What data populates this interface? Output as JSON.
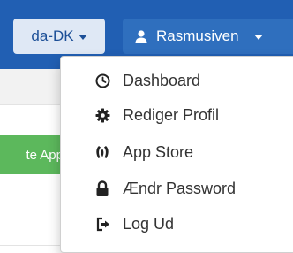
{
  "navbar": {
    "language": {
      "label": "da-DK"
    },
    "user": {
      "name": "Rasmusiven"
    }
  },
  "page": {
    "partial_button_label": "te App"
  },
  "user_menu": {
    "items": [
      {
        "label": "Dashboard",
        "icon": "dashboard-icon"
      },
      {
        "label": "Rediger Profil",
        "icon": "gear-icon"
      },
      {
        "label": "App Store",
        "icon": "app-store-icon"
      },
      {
        "label": "Ændr Password",
        "icon": "lock-icon"
      },
      {
        "label": "Log Ud",
        "icon": "sign-out-icon"
      }
    ]
  }
}
